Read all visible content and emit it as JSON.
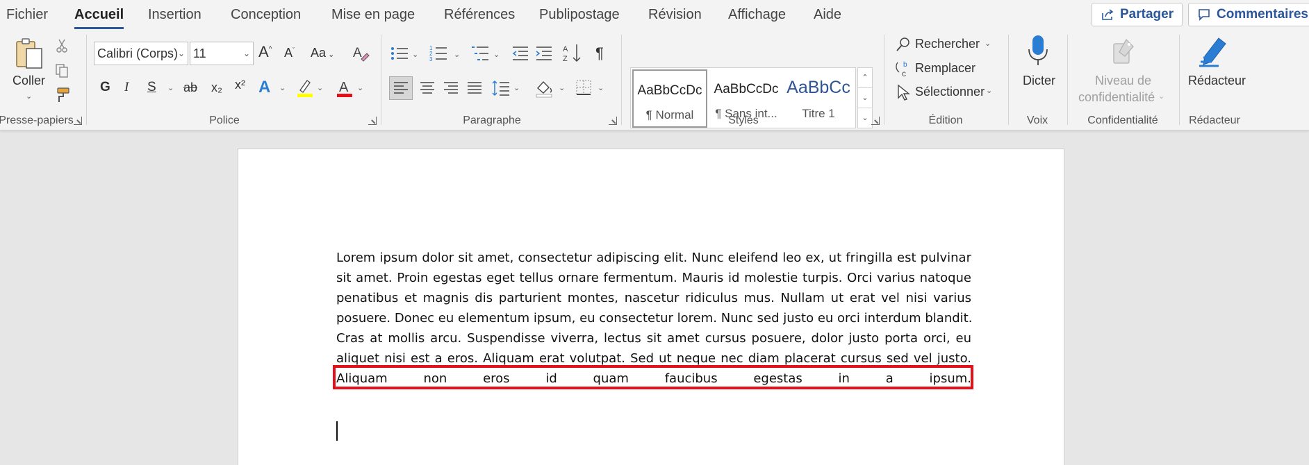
{
  "tabs": [
    "Fichier",
    "Accueil",
    "Insertion",
    "Conception",
    "Mise en page",
    "Références",
    "Publipostage",
    "Révision",
    "Affichage",
    "Aide"
  ],
  "active_tab": "Accueil",
  "top_buttons": {
    "share": "Partager",
    "comments": "Commentaires"
  },
  "clipboard": {
    "paste": "Coller",
    "group": "Presse-papiers"
  },
  "font": {
    "name": "Calibri (Corps)",
    "size": "11",
    "case": "Aa",
    "bold": "G",
    "italic": "I",
    "underline": "S",
    "strike": "ab",
    "sub": "x₂",
    "sup": "x²",
    "group": "Police"
  },
  "paragraph": {
    "group": "Paragraphe",
    "pilcrow": "¶"
  },
  "styles": {
    "items": [
      {
        "preview": "AaBbCcDc",
        "name": "¶ Normal"
      },
      {
        "preview": "AaBbCcDc",
        "name": "¶ Sans int..."
      },
      {
        "preview": "AaBbCc",
        "name": "Titre 1"
      }
    ],
    "group": "Styles"
  },
  "editing": {
    "find": "Rechercher",
    "replace": "Remplacer",
    "select": "Sélectionner",
    "group": "Édition"
  },
  "voice": {
    "dictate": "Dicter",
    "group": "Voix"
  },
  "sensitivity": {
    "label_line1": "Niveau de",
    "label_line2": "confidentialité",
    "group": "Confidentialité"
  },
  "editor": {
    "label": "Rédacteur",
    "group": "Rédacteur"
  },
  "document": {
    "lines": [
      "Lorem ipsum dolor sit amet, consectetur adipiscing elit. Nunc eleifend leo ex, ut fringilla est pulvinar",
      "sit amet. Proin egestas eget tellus ornare fermentum. Mauris id molestie turpis. Orci varius natoque",
      "penatibus et magnis dis parturient montes, nascetur ridiculus mus. Nullam ut erat vel nisi varius",
      "posuere. Donec eu elementum ipsum, eu consectetur lorem. Nunc sed justo eu orci interdum blandit.",
      "Cras at mollis arcu. Suspendisse viverra, lectus sit amet cursus posuere, dolor justo porta orci, eu",
      "aliquet nisi est a eros. Aliquam erat volutpat. Sed ut neque nec diam placerat cursus sed vel justo.",
      "Aliquam non eros id quam faucibus egestas in a ipsum."
    ]
  },
  "colors": {
    "accent": "#2b579a",
    "highlight_box": "#e3121a",
    "font_color": "#e3121a",
    "highlighter": "#ffff00"
  }
}
